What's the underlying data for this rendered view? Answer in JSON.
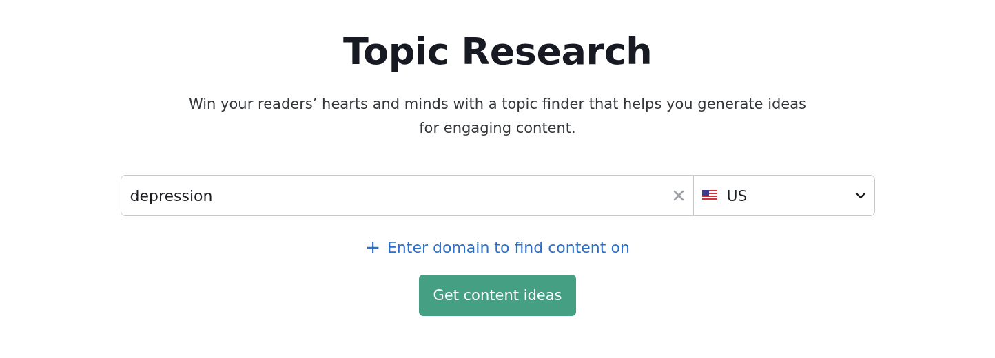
{
  "title": "Topic Research",
  "description": "Win your readers’ hearts and minds with a topic finder that helps you generate ideas for engaging content.",
  "search": {
    "value": "depression",
    "country": "US"
  },
  "domain_link": {
    "icon": "+",
    "label": "Enter domain to find content on"
  },
  "submit_button": "Get content ideas"
}
